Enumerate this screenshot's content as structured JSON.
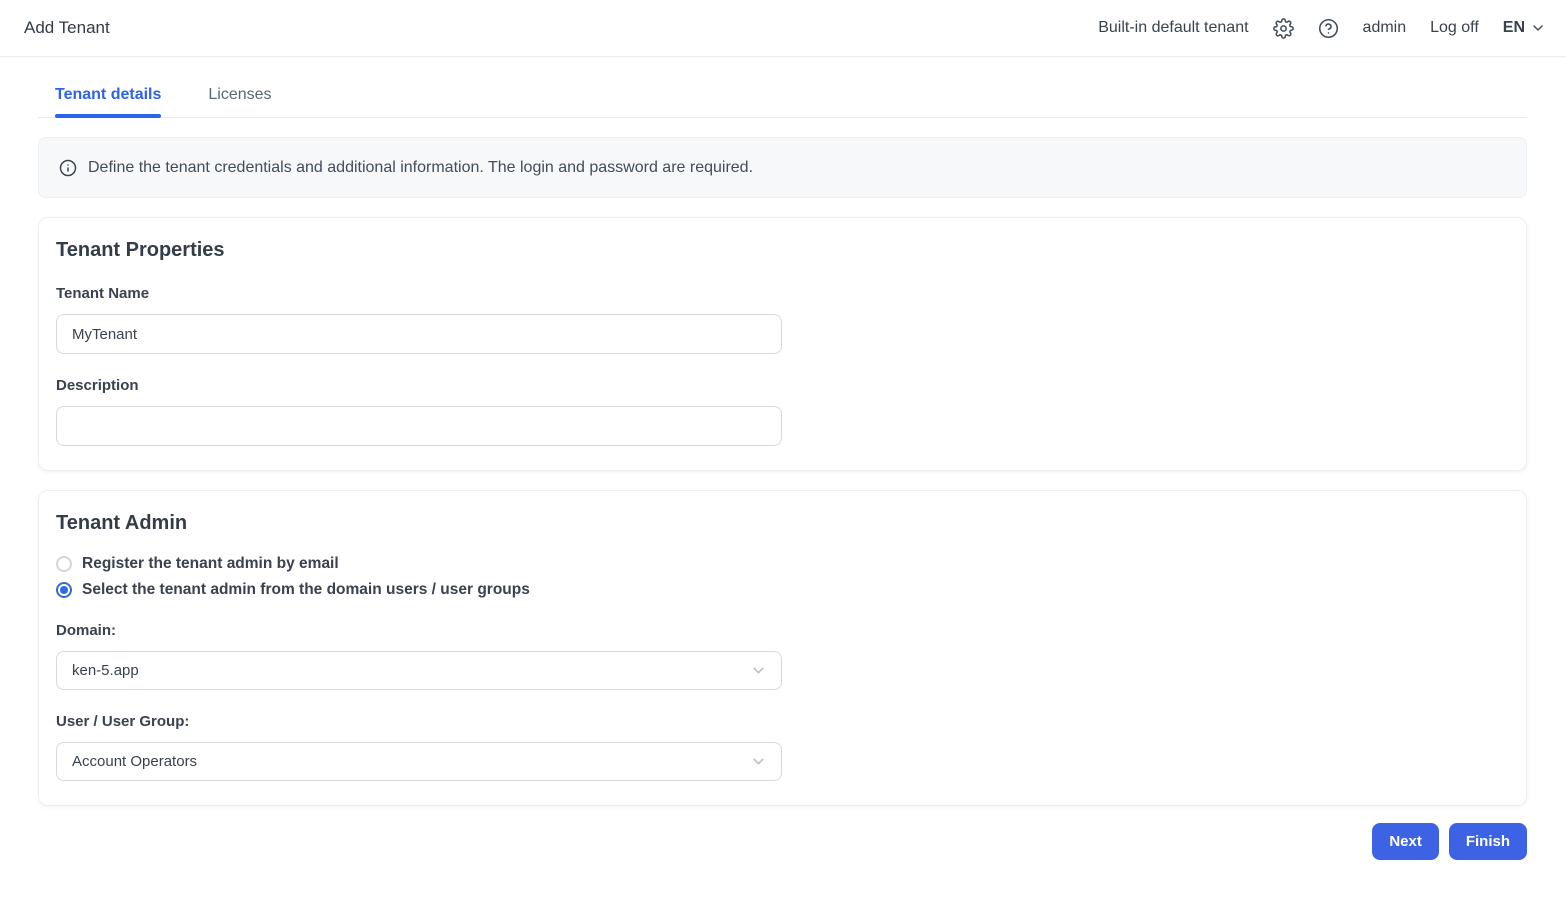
{
  "header": {
    "title": "Add Tenant",
    "tenant_label": "Built-in default tenant",
    "user": "admin",
    "logoff_label": "Log off",
    "language": "EN"
  },
  "tabs": [
    {
      "label": "Tenant details",
      "active": true
    },
    {
      "label": "Licenses",
      "active": false
    }
  ],
  "info_banner": {
    "text": "Define the tenant credentials and additional information. The login and password are required."
  },
  "tenant_properties": {
    "title": "Tenant Properties",
    "tenant_name_label": "Tenant Name",
    "tenant_name_value": "MyTenant",
    "description_label": "Description",
    "description_value": ""
  },
  "tenant_admin": {
    "title": "Tenant Admin",
    "radios": [
      {
        "label": "Register the tenant admin by email",
        "selected": false
      },
      {
        "label": "Select the tenant admin from the domain users / user groups",
        "selected": true
      }
    ],
    "domain_label": "Domain:",
    "domain_value": "ken-5.app",
    "user_group_label": "User / User Group:",
    "user_group_value": "Account Operators"
  },
  "footer": {
    "next_label": "Next",
    "finish_label": "Finish"
  },
  "colors": {
    "accent_blue": "#3d63e4",
    "tab_active_blue": "#2d63e8",
    "radio_blue": "#2f6bdf",
    "text_dark": "#39424e",
    "banner_bg": "#f7f8f9",
    "border_light": "#d6dade"
  }
}
